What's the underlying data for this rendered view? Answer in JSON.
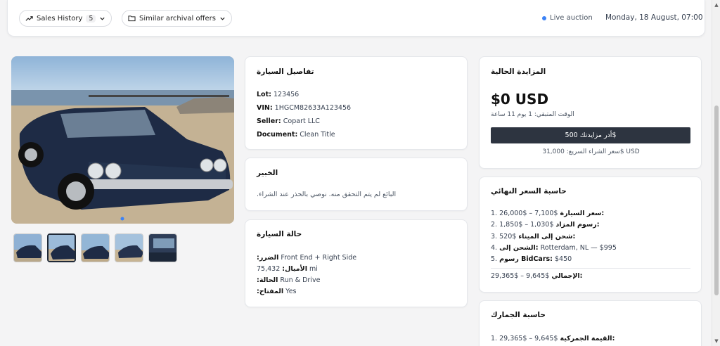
{
  "header": {
    "sales_history_label": "Sales History",
    "sales_history_count": "5",
    "similar_offers_label": "Similar archival offers",
    "live_label": "Live auction",
    "date_text": "Monday, 18 August, 07:00"
  },
  "gallery": {
    "thumb_count": 5,
    "active_thumb": 2
  },
  "car_details": {
    "title": "تفاصيل السيارة",
    "lot_label": "Lot:",
    "lot_value": "123456",
    "vin_label": "VIN:",
    "vin_value": "1HGCM82633A123456",
    "seller_label": "Seller:",
    "seller_value": "Copart LLC",
    "document_label": "Document:",
    "document_value": "Clean Title"
  },
  "expert": {
    "title": "الخبير",
    "note": ".البائع لم يتم التحقق منه. نوصي بالحذر عند الشراء"
  },
  "condition": {
    "title": "حالة السيارة",
    "damage_label": ":الضرر",
    "damage_value": "Front End + Right Side",
    "odometer_value": "75,432",
    "odometer_label": ":الأميال",
    "odometer_unit": "mi",
    "status_label": ":الحالة",
    "status_value": "Run & Drive",
    "keys_label": ":المفتاح",
    "keys_value": "Yes"
  },
  "auction": {
    "title": "المزايدة الحالية",
    "current_price": "$0 USD",
    "time_left": "الوقت المتبقي: 1 يوم 11 ساعة",
    "bid_button": "أدر مزايدتك 500$",
    "buy_now": "سعر الشراء السريع: 31,000$ USD"
  },
  "final_price": {
    "title": "حاسبة السعر النهائي",
    "items": [
      {
        "num": "1.",
        "label": "سعر السيارة:",
        "value": "26,000$ – 7,100$"
      },
      {
        "num": "2.",
        "label": "رسوم المزاد:",
        "value": "1,850$ – 1,030$"
      },
      {
        "num": "3.",
        "label": "شحن إلى الميناء:",
        "value": "520$"
      },
      {
        "num": "4.",
        "label": "الشحن إلى:",
        "value": "Rotterdam, NL — $995"
      },
      {
        "num": "5.",
        "label": "رسوم BidCars:",
        "value": "$450"
      }
    ],
    "total_label": "الإجمالي:",
    "total_value": "29,365$ – 9,645$"
  },
  "customs": {
    "title": "حاسبة الجمارك",
    "item_num": "1.",
    "item_label": "القيمة الجمركية:",
    "item_value": "29,365$ – 9,645$"
  }
}
